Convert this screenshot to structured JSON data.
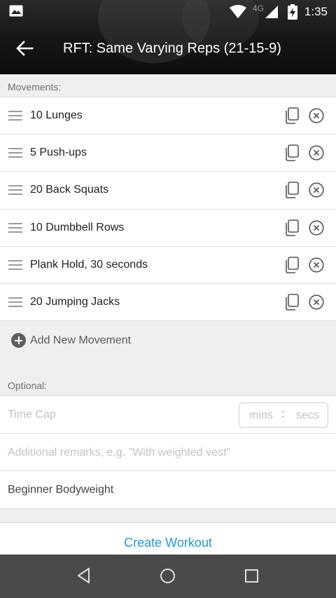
{
  "status_bar": {
    "network": "4G",
    "time": "1:35",
    "icons": [
      "image-icon",
      "wifi-icon",
      "signal-icon",
      "battery-charging-icon"
    ]
  },
  "toolbar": {
    "title": "RFT: Same Varying Reps (21-15-9)",
    "back_icon": "back-arrow-icon"
  },
  "movements": {
    "label": "Movements:",
    "items": [
      {
        "name": "10 Lunges"
      },
      {
        "name": "5 Push-ups"
      },
      {
        "name": "20 Back Squats"
      },
      {
        "name": "10 Dumbbell Rows"
      },
      {
        "name": "Plank Hold, 30 seconds"
      },
      {
        "name": "20 Jumping Jacks"
      }
    ],
    "add_label": "Add New Movement"
  },
  "optional": {
    "label": "Optional:",
    "time_cap_placeholder": "Time Cap",
    "mins_placeholder": "mins",
    "colon": ":",
    "secs_placeholder": "secs",
    "remarks_placeholder": "Additional remarks, e.g. \"With weighted vest\"",
    "category_value": "Beginner Bodyweight"
  },
  "actions": {
    "create_label": "Create Workout"
  },
  "colors": {
    "accent": "#1e9bd6",
    "navbar": "#4a4a4a",
    "header": "#151515"
  }
}
